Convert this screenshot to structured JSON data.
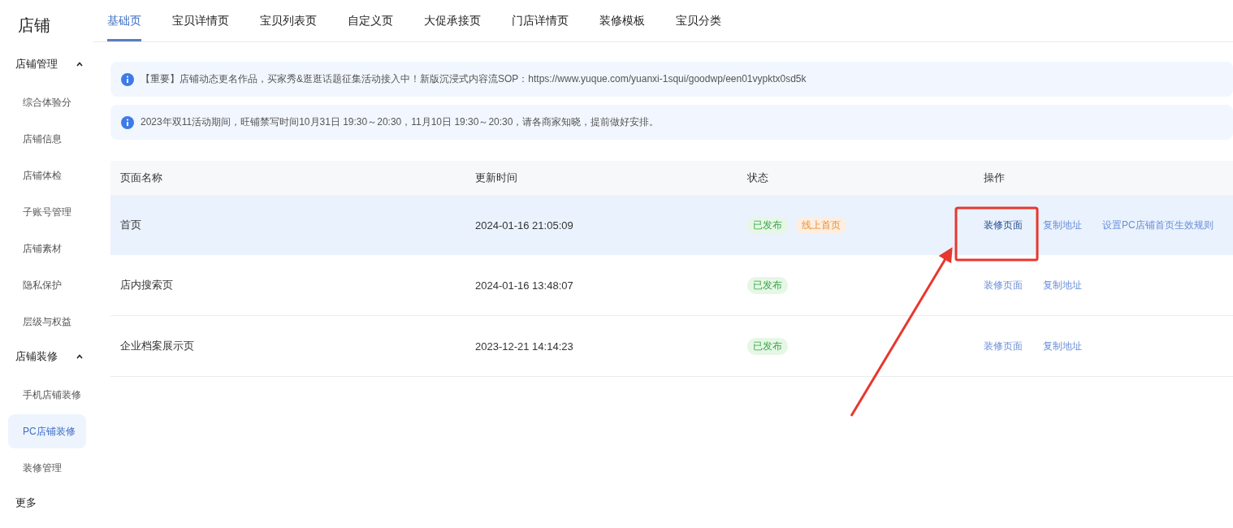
{
  "sidebar": {
    "title": "店铺",
    "groups": [
      {
        "label": "店铺管理",
        "expanded": true,
        "items": [
          {
            "label": "综合体验分",
            "selected": false
          },
          {
            "label": "店铺信息",
            "selected": false
          },
          {
            "label": "店铺体检",
            "selected": false
          },
          {
            "label": "子账号管理",
            "selected": false
          },
          {
            "label": "店铺素材",
            "selected": false
          },
          {
            "label": "隐私保护",
            "selected": false
          },
          {
            "label": "层级与权益",
            "selected": false
          }
        ]
      },
      {
        "label": "店铺装修",
        "expanded": true,
        "items": [
          {
            "label": "手机店铺装修",
            "selected": false
          },
          {
            "label": "PC店铺装修",
            "selected": true
          },
          {
            "label": "装修管理",
            "selected": false
          }
        ]
      },
      {
        "label": "更多"
      }
    ]
  },
  "tabs": [
    {
      "label": "基础页",
      "selected": true
    },
    {
      "label": "宝贝详情页",
      "selected": false
    },
    {
      "label": "宝贝列表页",
      "selected": false
    },
    {
      "label": "自定义页",
      "selected": false
    },
    {
      "label": "大促承接页",
      "selected": false
    },
    {
      "label": "门店详情页",
      "selected": false
    },
    {
      "label": "装修模板",
      "selected": false
    },
    {
      "label": "宝贝分类",
      "selected": false
    }
  ],
  "notices": [
    "【重要】店铺动态更名作品，买家秀&逛逛话题征集活动接入中！新版沉浸式内容流SOP：https://www.yuque.com/yuanxi-1squi/goodwp/een01vypktx0sd5k",
    "2023年双11活动期间，旺铺禁写时间10月31日 19:30～20:30，11月10日 19:30～20:30，请各商家知晓，提前做好安排。"
  ],
  "table": {
    "columns": [
      "页面名称",
      "更新时间",
      "状态",
      "操作"
    ],
    "rows": [
      {
        "name": "首页",
        "updated": "2024-01-16 21:05:09",
        "highlighted": true,
        "tags": [
          {
            "label": "已发布",
            "kind": "published"
          },
          {
            "label": "线上首页",
            "kind": "online"
          }
        ],
        "actions": [
          {
            "label": "装修页面",
            "hovered": true
          },
          {
            "label": "复制地址",
            "hovered": false
          },
          {
            "label": "设置PC店铺首页生效规则",
            "hovered": false
          }
        ]
      },
      {
        "name": "店内搜索页",
        "updated": "2024-01-16 13:48:07",
        "highlighted": false,
        "tags": [
          {
            "label": "已发布",
            "kind": "published"
          }
        ],
        "actions": [
          {
            "label": "装修页面",
            "hovered": false
          },
          {
            "label": "复制地址",
            "hovered": false
          }
        ]
      },
      {
        "name": "企业档案展示页",
        "updated": "2023-12-21 14:14:23",
        "highlighted": false,
        "tags": [
          {
            "label": "已发布",
            "kind": "published"
          }
        ],
        "actions": [
          {
            "label": "装修页面",
            "hovered": false
          },
          {
            "label": "复制地址",
            "hovered": false
          }
        ]
      }
    ]
  }
}
